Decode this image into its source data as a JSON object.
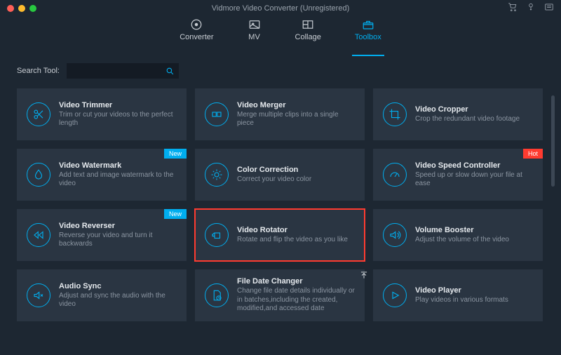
{
  "title": "Vidmore Video Converter (Unregistered)",
  "nav": {
    "converter": "Converter",
    "mv": "MV",
    "collage": "Collage",
    "toolbox": "Toolbox"
  },
  "search": {
    "label": "Search Tool:"
  },
  "badges": {
    "new": "New",
    "hot": "Hot"
  },
  "tools": {
    "trimmer": {
      "title": "Video Trimmer",
      "desc": "Trim or cut your videos to the perfect length"
    },
    "merger": {
      "title": "Video Merger",
      "desc": "Merge multiple clips into a single piece"
    },
    "cropper": {
      "title": "Video Cropper",
      "desc": "Crop the redundant video footage"
    },
    "watermark": {
      "title": "Video Watermark",
      "desc": "Add text and image watermark to the video"
    },
    "color": {
      "title": "Color Correction",
      "desc": "Correct your video color"
    },
    "speed": {
      "title": "Video Speed Controller",
      "desc": "Speed up or slow down your file at ease"
    },
    "reverser": {
      "title": "Video Reverser",
      "desc": "Reverse your video and turn it backwards"
    },
    "rotator": {
      "title": "Video Rotator",
      "desc": "Rotate and flip the video as you like"
    },
    "volume": {
      "title": "Volume Booster",
      "desc": "Adjust the volume of the video"
    },
    "sync": {
      "title": "Audio Sync",
      "desc": "Adjust and sync the audio with the video"
    },
    "filedate": {
      "title": "File Date Changer",
      "desc": "Change file date details individually or in batches,including the created, modified,and accessed date"
    },
    "player": {
      "title": "Video Player",
      "desc": "Play videos in various formats"
    }
  }
}
